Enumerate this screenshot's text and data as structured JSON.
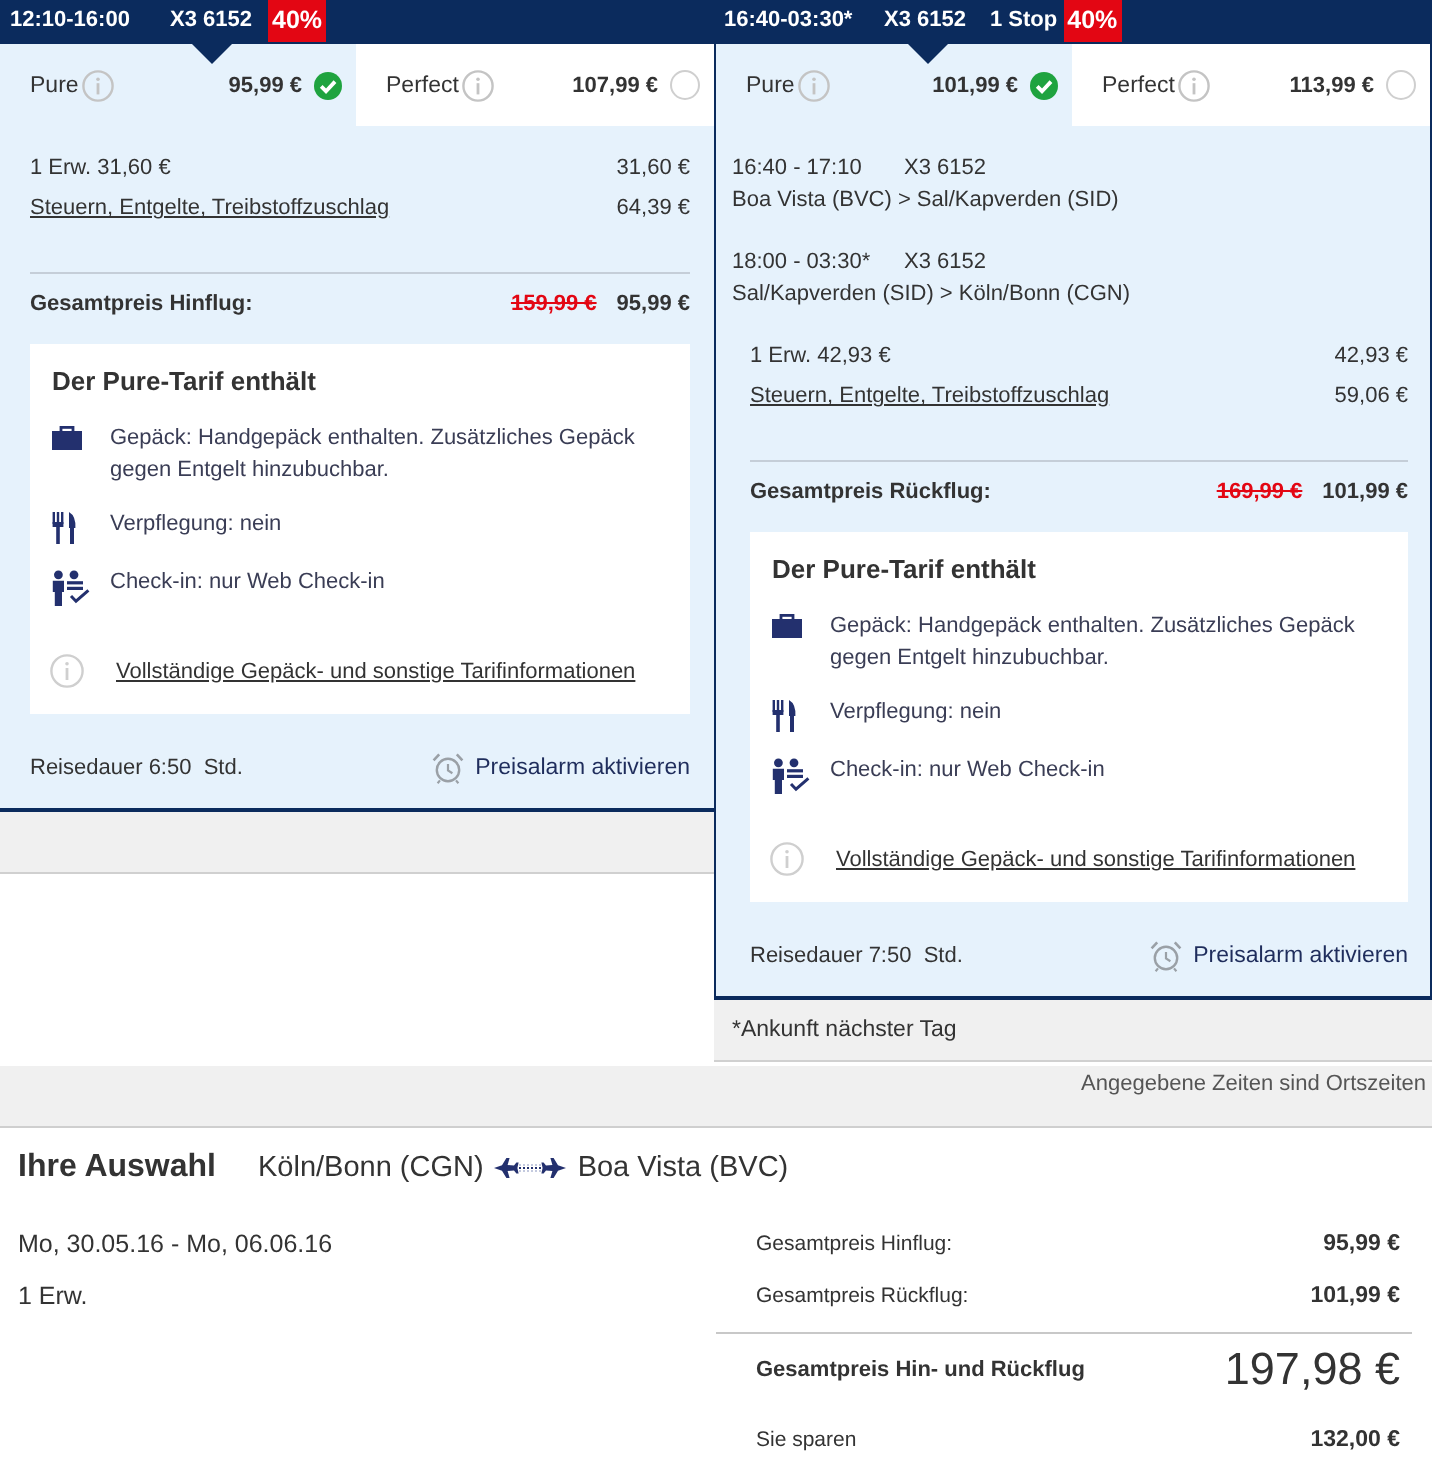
{
  "flights": [
    {
      "header": {
        "time": "12:10-16:00",
        "flight": "X3 6152",
        "discount": "40%"
      },
      "fares": [
        {
          "name": "Pure",
          "price": "95,99 €",
          "selected": true
        },
        {
          "name": "Perfect",
          "price": "107,99 €",
          "selected": false
        }
      ],
      "price_rows": [
        {
          "kind": "text",
          "label": "1 Erw. 31,60 €",
          "amount": "31,60 €"
        },
        {
          "kind": "link",
          "label": "Steuern, Entgelte, Treibstoffzuschlag",
          "amount": "64,39 €"
        }
      ],
      "total": {
        "label": "Gesamtpreis Hinflug:",
        "old_price": "159,99 €",
        "price": "95,99 €"
      },
      "tariff": {
        "title": "Der Pure-Tarif enthält",
        "features": [
          {
            "kind": "baggage",
            "text": "Gepäck: Handgepäck enthalten. Zusätzliches Gepäck gegen Entgelt hinzubuchbar."
          },
          {
            "kind": "meals",
            "text": "Verpflegung: nein"
          },
          {
            "kind": "checkin",
            "text": "Check-in: nur Web Check-in"
          }
        ],
        "link": "Vollständige Gepäck- und sonstige Tarifinformationen"
      },
      "duration": "Reisedauer 6:50  Std.",
      "price_alert": "Preisalarm aktivieren"
    },
    {
      "header": {
        "time": "16:40-03:30*",
        "flight": "X3 6152",
        "stops": "1 Stop",
        "discount": "40%"
      },
      "fares": [
        {
          "name": "Pure",
          "price": "101,99 €",
          "selected": true
        },
        {
          "name": "Perfect",
          "price": "113,99 €",
          "selected": false
        }
      ],
      "segments": [
        {
          "times": "16:40 - 17:10",
          "flight": "X3 6152",
          "route": "Boa Vista (BVC) > Sal/Kapverden (SID)"
        },
        {
          "times": "18:00 - 03:30*",
          "flight": "X3 6152",
          "route": "Sal/Kapverden (SID) > Köln/Bonn (CGN)"
        }
      ],
      "price_rows": [
        {
          "kind": "text",
          "label": "1 Erw. 42,93 €",
          "amount": "42,93 €"
        },
        {
          "kind": "link",
          "label": "Steuern, Entgelte, Treibstoffzuschlag",
          "amount": "59,06 €"
        }
      ],
      "total": {
        "label": "Gesamtpreis Rückflug:",
        "old_price": "169,99 €",
        "price": "101,99 €"
      },
      "tariff": {
        "title": "Der Pure-Tarif enthält",
        "features": [
          {
            "kind": "baggage",
            "text": "Gepäck: Handgepäck enthalten. Zusätzliches Gepäck gegen Entgelt hinzubuchbar."
          },
          {
            "kind": "meals",
            "text": "Verpflegung: nein"
          },
          {
            "kind": "checkin",
            "text": "Check-in: nur Web Check-in"
          }
        ],
        "link": "Vollständige Gepäck- und sonstige Tarifinformationen"
      },
      "duration": "Reisedauer 7:50  Std.",
      "price_alert": "Preisalarm aktivieren",
      "footnote": "*Ankunft nächster Tag"
    }
  ],
  "time_note": "Angegebene Zeiten sind Ortszeiten",
  "summary": {
    "title": "Ihre Auswahl",
    "origin": "Köln/Bonn (CGN)",
    "destination": "Boa Vista (BVC)",
    "dates": "Mo, 30.05.16 - Mo, 06.06.16",
    "passengers": "1 Erw.",
    "lines": [
      {
        "kind": "subtotal",
        "label": "Gesamtpreis Hinflug:",
        "amount": "95,99 €"
      },
      {
        "kind": "subtotal",
        "label": "Gesamtpreis Rückflug:",
        "amount": "101,99 €"
      },
      {
        "kind": "grand_total",
        "label": "Gesamtpreis Hin- und Rückflug",
        "amount": "197,98 €"
      },
      {
        "kind": "savings",
        "label": "Sie sparen",
        "amount": "132,00 €"
      }
    ]
  }
}
